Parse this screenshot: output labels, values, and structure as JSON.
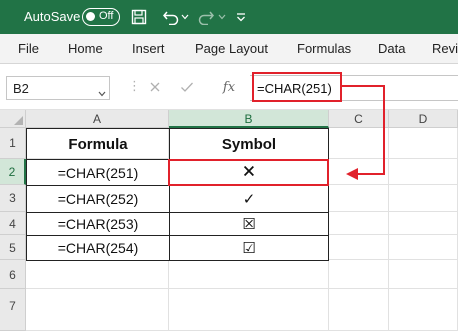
{
  "titlebar": {
    "autosave_label": "AutoSave",
    "autosave_state": "Off",
    "color": "#217346",
    "icons": [
      "save-icon",
      "undo-icon",
      "redo-icon",
      "more-icon"
    ]
  },
  "ribbon": {
    "tabs": [
      "File",
      "Home",
      "Insert",
      "Page Layout",
      "Formulas",
      "Data",
      "Revi"
    ]
  },
  "formula_bar": {
    "name_box": "B2",
    "formula": "=CHAR(251)",
    "fx_label": "fx"
  },
  "grid": {
    "columns": [
      "A",
      "B",
      "C",
      "D"
    ],
    "rows": [
      "1",
      "2",
      "3",
      "4",
      "5",
      "6",
      "7"
    ],
    "selected_cell": "B2",
    "table": {
      "headers": [
        "Formula",
        "Symbol"
      ],
      "rows": [
        {
          "formula": "=CHAR(251)",
          "symbol": "🗙"
        },
        {
          "formula": "=CHAR(252)",
          "symbol": "✓"
        },
        {
          "formula": "=CHAR(253)",
          "symbol": "☒"
        },
        {
          "formula": "=CHAR(254)",
          "symbol": "☑"
        }
      ]
    }
  },
  "annotation": {
    "color": "#e1212b"
  }
}
